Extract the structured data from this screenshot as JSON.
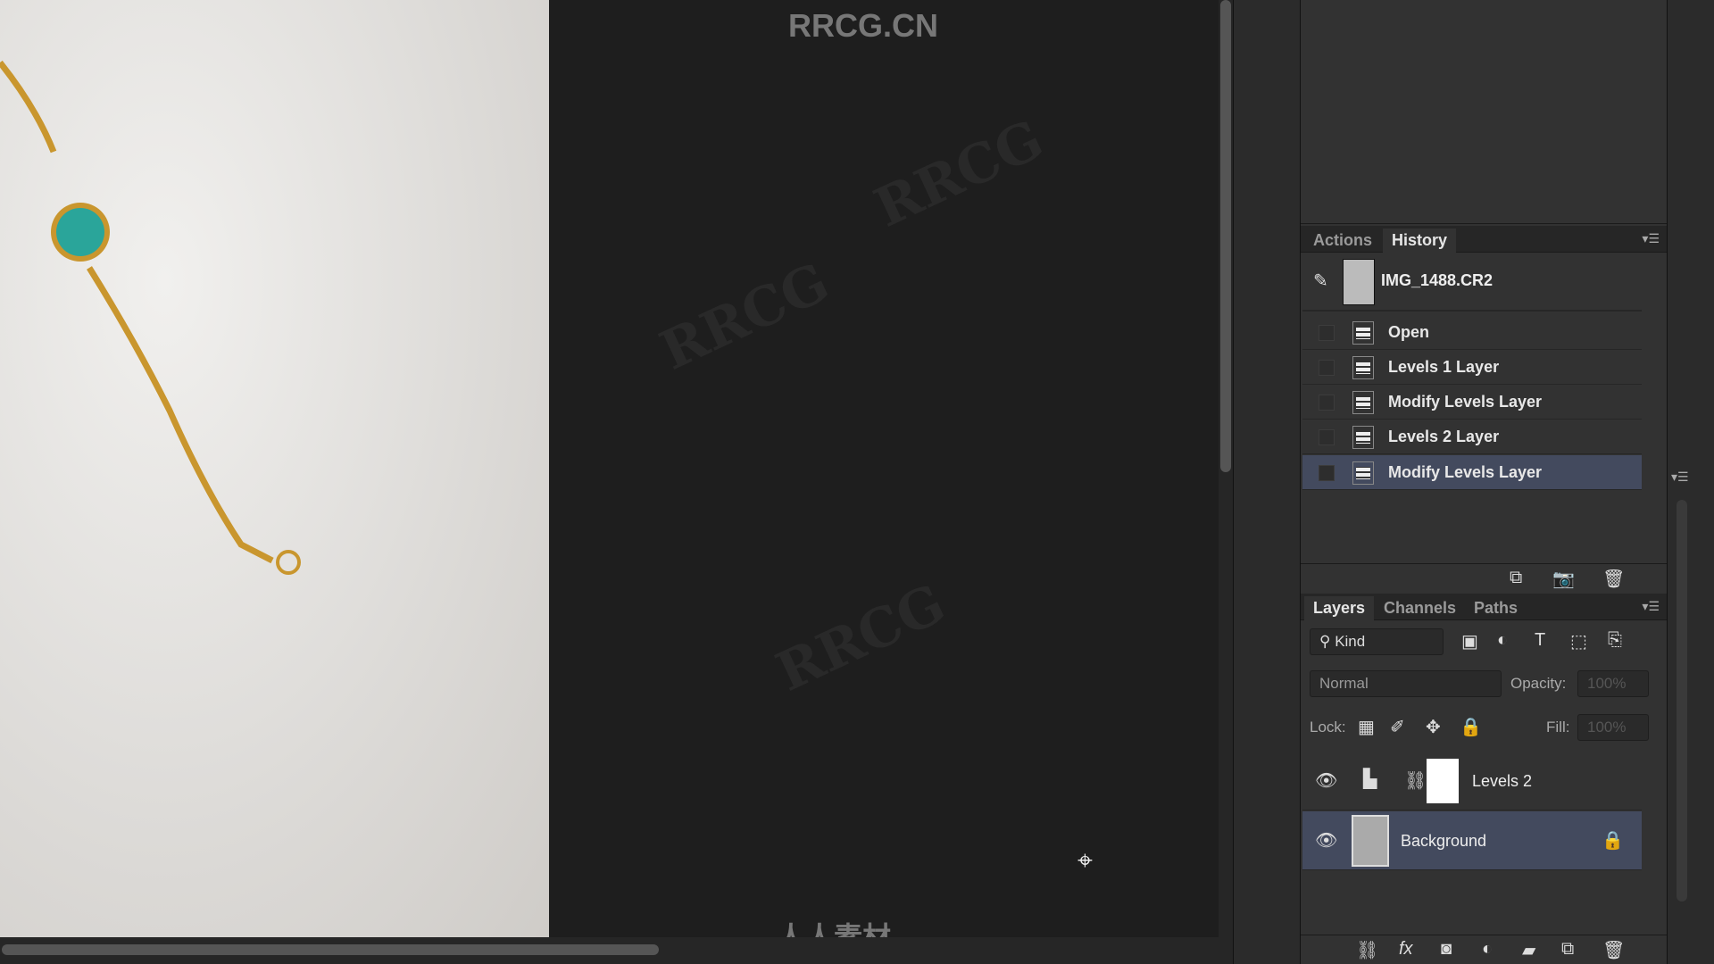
{
  "watermark": {
    "top": "RRCG.CN",
    "bottom": "人人素材",
    "repeat": "RRCG"
  },
  "history_panel": {
    "tabs": [
      {
        "label": "Actions",
        "active": false
      },
      {
        "label": "History",
        "active": true
      }
    ],
    "snapshot": {
      "label": "IMG_1488.CR2"
    },
    "items": [
      {
        "label": "Open",
        "selected": false
      },
      {
        "label": "Levels 1 Layer",
        "selected": false
      },
      {
        "label": "Modify Levels Layer",
        "selected": false
      },
      {
        "label": "Levels 2 Layer",
        "selected": false
      },
      {
        "label": "Modify Levels Layer",
        "selected": true
      }
    ]
  },
  "layers_panel": {
    "tabs": [
      {
        "label": "Layers",
        "active": true
      },
      {
        "label": "Channels",
        "active": false
      },
      {
        "label": "Paths",
        "active": false
      }
    ],
    "filter": {
      "label": "Kind"
    },
    "blend_mode": "Normal",
    "opacity_label": "Opacity:",
    "opacity_value": "100%",
    "lock_label": "Lock:",
    "fill_label": "Fill:",
    "fill_value": "100%",
    "layers": [
      {
        "name": "Levels 2",
        "type": "adjustment",
        "visible": true,
        "selected": false
      },
      {
        "name": "Background",
        "type": "image",
        "visible": true,
        "selected": true,
        "locked": true
      }
    ]
  },
  "colors": {
    "selection": "#434a5e",
    "panel": "#323232",
    "canvas": "#1e1e1e",
    "gem": "#2aa59a",
    "chain": "#c9962e"
  }
}
